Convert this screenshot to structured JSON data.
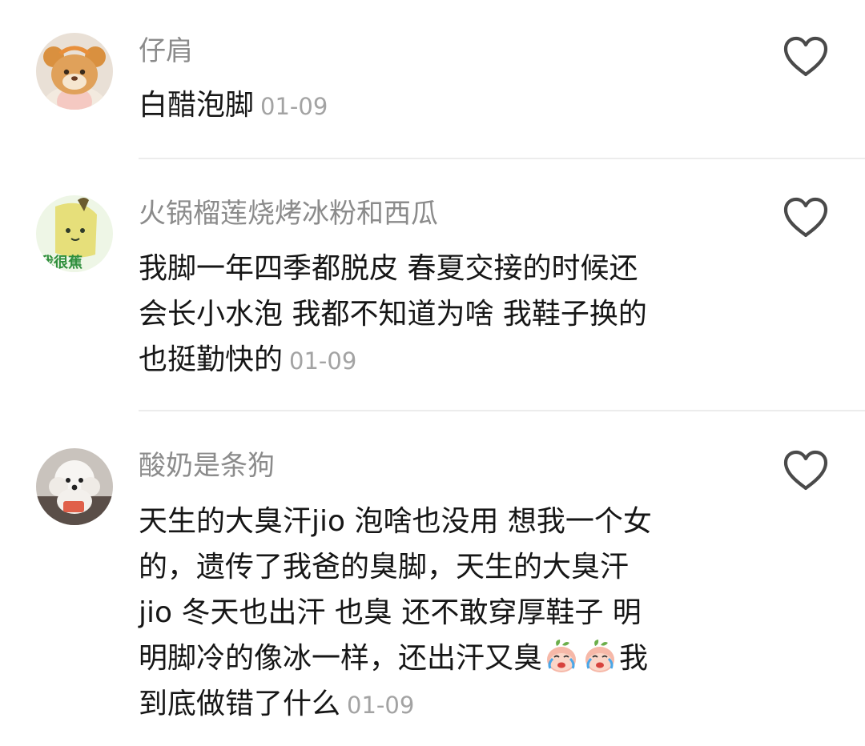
{
  "comments": [
    {
      "username": "仔肩",
      "lines": [
        "白醋泡脚"
      ],
      "date": "01-09",
      "avatar_icon": "bear-plush-icon"
    },
    {
      "username": "火锅榴莲烧烤冰粉和西瓜",
      "lines": [
        "我脚一年四季都脱皮 春夏交接的时候还",
        "会长小水泡 我都不知道为啥 我鞋子换的",
        "也挺勤快的"
      ],
      "date": "01-09",
      "avatar_icon": "banana-avatar-icon",
      "avatar_text": "我很蕉"
    },
    {
      "username": "酸奶是条狗",
      "lines": [
        "天生的大臭汗jio 泡啥也没用 想我一个女",
        "的，遗传了我爸的臭脚，天生的大臭汗",
        "jio 冬天也出汗 也臭 还不敢穿厚鞋子 明",
        "明脚冷的像冰一样，还出汗又臭",
        "我",
        "到底做错了什么"
      ],
      "date": "01-09",
      "avatar_icon": "white-dog-icon"
    }
  ],
  "colors": {
    "username": "#8b8b8b",
    "text": "#161616",
    "date": "#a3a3a3",
    "like_outline": "#4a4a4a",
    "divider": "#ececec"
  },
  "icons": {
    "like": "heart-outline-icon",
    "crying": "crying-peach-emoji-icon"
  }
}
